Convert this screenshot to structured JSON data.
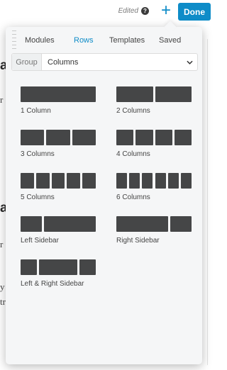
{
  "topbar": {
    "edited_label": "Edited",
    "help_symbol": "?",
    "add_symbol": "+",
    "done_label": "Done"
  },
  "background_fragments": {
    "headings": [
      "a",
      "a"
    ],
    "lines": [
      "r",
      "r",
      "y",
      "tr"
    ]
  },
  "panel": {
    "tabs": [
      {
        "label": "Modules",
        "active": false
      },
      {
        "label": "Rows",
        "active": true
      },
      {
        "label": "Templates",
        "active": false
      },
      {
        "label": "Saved",
        "active": false
      }
    ],
    "group_select": {
      "label": "Group",
      "value": "Columns"
    },
    "layouts": [
      {
        "id": "1-column",
        "label": "1 Column",
        "columns": [
          1
        ]
      },
      {
        "id": "2-columns",
        "label": "2 Columns",
        "columns": [
          1,
          1
        ]
      },
      {
        "id": "3-columns",
        "label": "3 Columns",
        "columns": [
          1,
          1,
          1
        ]
      },
      {
        "id": "4-columns",
        "label": "4 Columns",
        "columns": [
          1,
          1,
          1,
          1
        ]
      },
      {
        "id": "5-columns",
        "label": "5 Columns",
        "columns": [
          1,
          1,
          1,
          1,
          1
        ]
      },
      {
        "id": "6-columns",
        "label": "6 Columns",
        "columns": [
          1,
          1,
          1,
          1,
          1,
          1
        ]
      },
      {
        "id": "left-sidebar",
        "label": "Left Sidebar",
        "columns": [
          1,
          2.4
        ]
      },
      {
        "id": "right-sidebar",
        "label": "Right Sidebar",
        "columns": [
          2.4,
          1
        ]
      },
      {
        "id": "left-right-sidebar",
        "label": "Left & Right Sidebar",
        "columns": [
          1,
          2.4,
          1
        ]
      }
    ]
  },
  "colors": {
    "accent": "#0e8cc8",
    "block": "#454647",
    "panel_bg": "#f5f6f7"
  }
}
